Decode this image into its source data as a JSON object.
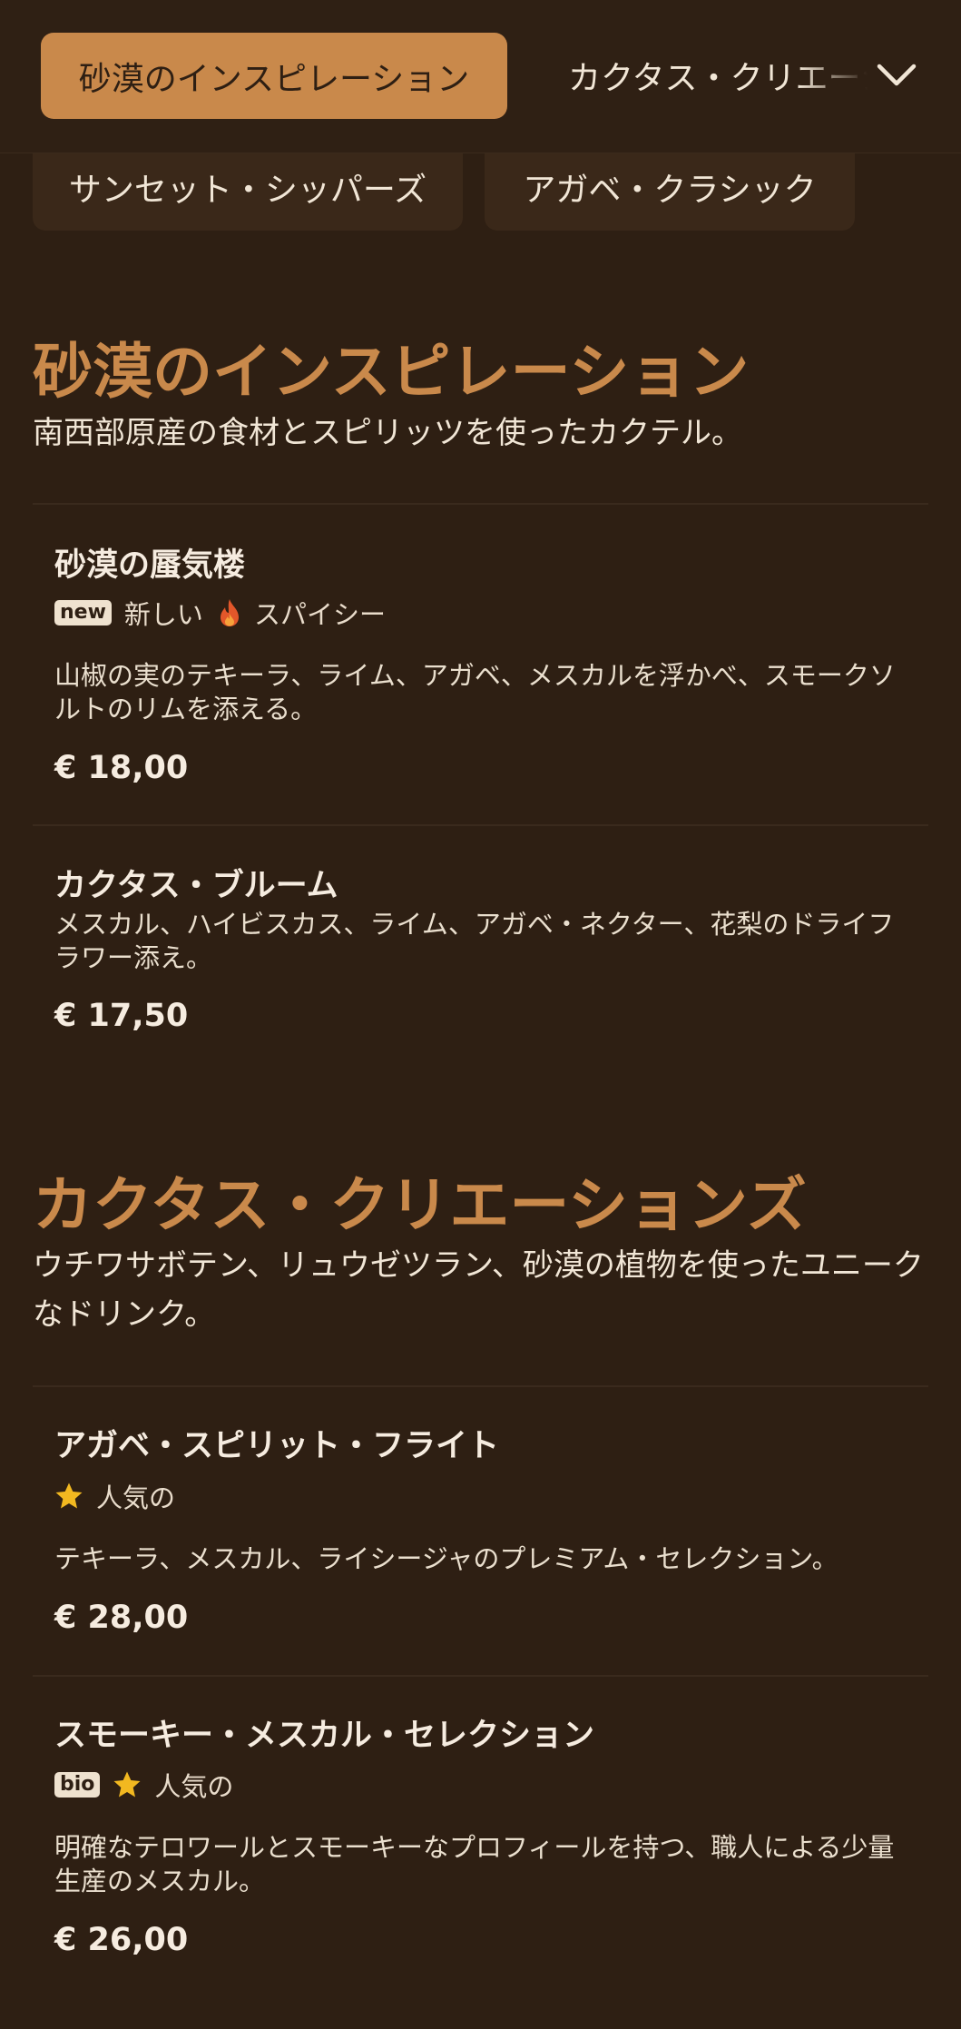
{
  "nav": {
    "active_tab": "砂漠のインスピレーション",
    "next_tab": "カクタス・クリエーションズ",
    "chips": [
      "サンセット・シッパーズ",
      "アガベ・クラシック"
    ]
  },
  "sections": [
    {
      "title": "砂漠のインスピレーション",
      "description": "南西部原産の食材とスピリッツを使ったカクテル。",
      "items": [
        {
          "name": "砂漠の蜃気楼",
          "badge": "new",
          "badge_label": "新しい",
          "tag_icon": "flame-icon",
          "tag_label": "スパイシー",
          "description": "山椒の実のテキーラ、ライム、アガベ、メスカルを浮かべ、スモークソルトのリムを添える。",
          "price": "€ 18,00"
        },
        {
          "name": "カクタス・ブルーム",
          "description": "メスカル、ハイビスカス、ライム、アガベ・ネクター、花梨のドライフラワー添え。",
          "price": "€ 17,50"
        }
      ]
    },
    {
      "title": "カクタス・クリエーションズ",
      "description": "ウチワサボテン、リュウゼツラン、砂漠の植物を使ったユニークなドリンク。",
      "items": [
        {
          "name": "アガベ・スピリット・フライト",
          "tag_icon": "star-icon",
          "tag_label": "人気の",
          "description": "テキーラ、メスカル、ライシージャのプレミアム・セレクション。",
          "price": "€ 28,00"
        },
        {
          "name": "スモーキー・メスカル・セレクション",
          "badge": "bio",
          "tag_icon": "star-icon",
          "tag_label": "人気の",
          "description": "明確なテロワールとスモーキーなプロフィールを持つ、職人による少量生産のメスカル。",
          "price": "€ 26,00"
        }
      ]
    }
  ],
  "colors": {
    "background": "#2e1f13",
    "accent": "#c9894b",
    "flame": "#e2572a",
    "star": "#f2b820"
  }
}
